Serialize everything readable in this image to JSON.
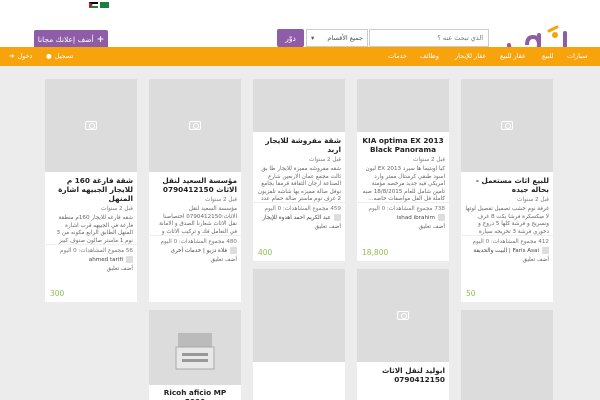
{
  "header": {
    "post_ad_label": "أضف إعلانك مجانا",
    "search_button": "دوّر",
    "category_select": "جميع الأقسام",
    "search_placeholder": "الذي تبحث عنه ؟"
  },
  "nav": {
    "login": "دخول",
    "register": "تسجيل",
    "items": [
      "سيارات",
      "للبيع",
      "عقار للبيع",
      "عقار للإيجار",
      "وظائف",
      "خدمات"
    ]
  },
  "cards": [
    {
      "title": "شقة فارغة 160 م للايجار الجبيهه اشارة المنهل",
      "time": "قبل 2 سنوات",
      "desc": "شقه فارغه للايجار 160م منطقة فارغة في الجبيهه قرب اشارة المنهل الطابق الرابع مكونه من 3 نوم 1 ماستر صالون صنوف كبير غرفة معيشة و مطبخ راكب معه برنده...",
      "views": "56 مجموع المشاهدات: 0 اليوم",
      "user": "ahmed tarifi",
      "price": "300",
      "comment": "أضف تعليق"
    },
    {
      "title": "مؤسسة السعيد لنقل الاثاث 0790412150",
      "time": "قبل 2 سنوات",
      "desc": "مؤسسة السعيد لنقل الاثاث:0790412150 اختصاصنا نقل الاثاث شعارنا الصدق و الامانة في التعامل فك و تركيب الاثاث و عمل نقل صبغة الاثاث بطيب قلبك ع الاثاث...",
      "views": "480 مجموع المشاهدات: 0 اليوم",
      "user": "فلاة دزيو | خدمات أخرى",
      "comment": "أضف تعليق"
    },
    {
      "title": "شقة مفروشة للايجار اربد",
      "time": "قبل 2 سنوات",
      "desc": "شقه مفروشه مميزة للايجار طا بق ثالث مجمع عمان الاربعين شارع الصناعة ارجان الثقافة قرمقا بجامع نوفل صالة مميزه بها شاشه تلفزيون 2 غرف نوم ماستر صالة حمام عدد 2 مطبخ...",
      "views": "459 مجموع المشاهدات: 0 اليوم",
      "user": "عبد الكريم احمد اهدوة للإيجار",
      "price": "400",
      "comment": "أضف تعليق"
    },
    {
      "title": "KIA optima EX 2013 Black Panorama",
      "time": "قبل 2 سنوات",
      "desc": "كيا اوبتيما ها سبرد 2013 EX ليون اسود طبقي كرستال ممتر وارد امريكي فيه جديد مرخصه مؤمنة تامين شامل للعام 18/8/2015 صبه كاملة فل الفل مواصفات خاصه... من الداخل مباغرة...",
      "views": "738 مجموع المشاهدات: 0 اليوم",
      "user": "ishad ibrahim",
      "price": "18,800",
      "comment": "أضف تعليق"
    },
    {
      "title": "للبيع اثاث مستعمل - بحاله جيده",
      "time": "قبل 2 سنوات",
      "desc": "غرفة نوم خشب تصميل تفصيل لوتها لا ميكسكرة فرشا بكت 8 غرف ونسريح و فرشة كلها 5 دروج و دخوري فرشة 3 تخريجه سيارة طقب علية بالاضافة 1200 دينار اربد...",
      "views": "412 مجموع المشاهدات: 0 اليوم",
      "user": "Faris Asai | البيت والحديقة",
      "price": "50",
      "comment": "أضف تعليق"
    },
    {
      "title": "Ricoh aficio MP 5000"
    },
    {
      "title": "ابوليد لنقل الاثاث 0790412150"
    }
  ]
}
